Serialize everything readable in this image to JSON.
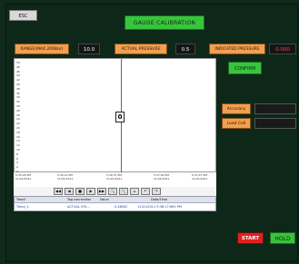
{
  "header": {
    "esc_label": "ESC",
    "title": "GAUGE CALIBRATION"
  },
  "controls": {
    "range_label": "RANGE(MAX.200Bar)",
    "range_value": "10.0",
    "actual_label": "ACTUAL PRESSURE",
    "actual_value": "0.5",
    "indicated_label": "INDICATED PRESSURE",
    "indicated_value": "0.000"
  },
  "trend": {
    "y_ticks": [
      "50",
      "48",
      "46",
      "44",
      "42",
      "40",
      "38",
      "36",
      "34",
      "32",
      "30",
      "28",
      "26",
      "24",
      "22",
      "20",
      "18",
      "16",
      "14",
      "12",
      "10",
      "8",
      "6",
      "4",
      "2",
      "0"
    ],
    "x_ticks": [
      {
        "time": "5:35:45 PM",
        "date": "11/21/2011"
      },
      {
        "time": "5:36:12 PM",
        "date": "11/21/2011"
      },
      {
        "time": "5:36:37 PM",
        "date": "11/21/2011"
      },
      {
        "time": "5:37:02 PM",
        "date": "11/21/2011"
      },
      {
        "time": "5:37:27 PM",
        "date": "11/21/2011"
      }
    ],
    "cursor_value": "0",
    "toolbar": [
      "◀◀",
      "◀",
      "■",
      "▶",
      "▶▶",
      "🔍",
      "🔍",
      "⌂",
      "↶",
      "↷"
    ],
    "grid": {
      "headers": [
        "Trend",
        "Tag connection",
        "Value",
        "Date/Time"
      ],
      "row": [
        "Trend_1",
        "ACTUAL SYS...",
        "0.46000",
        "11/21/2011 5:36:17:690 PM"
      ]
    }
  },
  "right": {
    "confirm_label": "CONFIRM",
    "accuracy_label": "Accuracy",
    "loadcell_label": "Load Cell"
  },
  "bottom": {
    "start_label": "START",
    "hold_label": "HOLD"
  },
  "colors": {
    "background": "#0f2a1a",
    "green": "#39c43e",
    "orange": "#f0a050",
    "red": "#e02020",
    "indicated_value": "#ff4040"
  }
}
